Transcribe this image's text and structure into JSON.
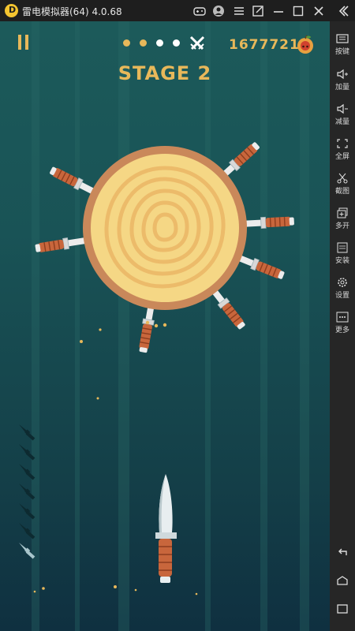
{
  "window": {
    "title": "雷电模拟器(64) 4.0.68",
    "logo_letter": "D"
  },
  "titlebar_icons": [
    "gamepad-icon",
    "user-icon",
    "menu-icon",
    "popout-icon",
    "minimize-icon",
    "maximize-icon",
    "close-icon",
    "collapse-icon"
  ],
  "sidebar": {
    "items": [
      {
        "label": "按键",
        "icon": "keyboard-icon"
      },
      {
        "label": "加量",
        "icon": "volume-up-icon"
      },
      {
        "label": "减量",
        "icon": "volume-down-icon"
      },
      {
        "label": "全屏",
        "icon": "fullscreen-icon"
      },
      {
        "label": "截图",
        "icon": "scissors-icon"
      },
      {
        "label": "多开",
        "icon": "multi-open-icon"
      },
      {
        "label": "安装",
        "icon": "apk-icon"
      },
      {
        "label": "设置",
        "icon": "gear-icon"
      },
      {
        "label": "更多",
        "icon": "more-icon"
      }
    ],
    "nav": [
      "back-icon",
      "home-icon",
      "recents-icon"
    ]
  },
  "game": {
    "stage_label": "STAGE 2",
    "score": "16777215",
    "stage_dots": {
      "completed": 2,
      "total": 4,
      "boss": true
    },
    "knives_remaining": 1,
    "knives_total": 7,
    "colors": {
      "accent": "#e8b85a",
      "background": "#1a5656",
      "log_rim": "#c9885a",
      "log_face": "#f5d785",
      "knife_handle": "#c8663c"
    }
  }
}
